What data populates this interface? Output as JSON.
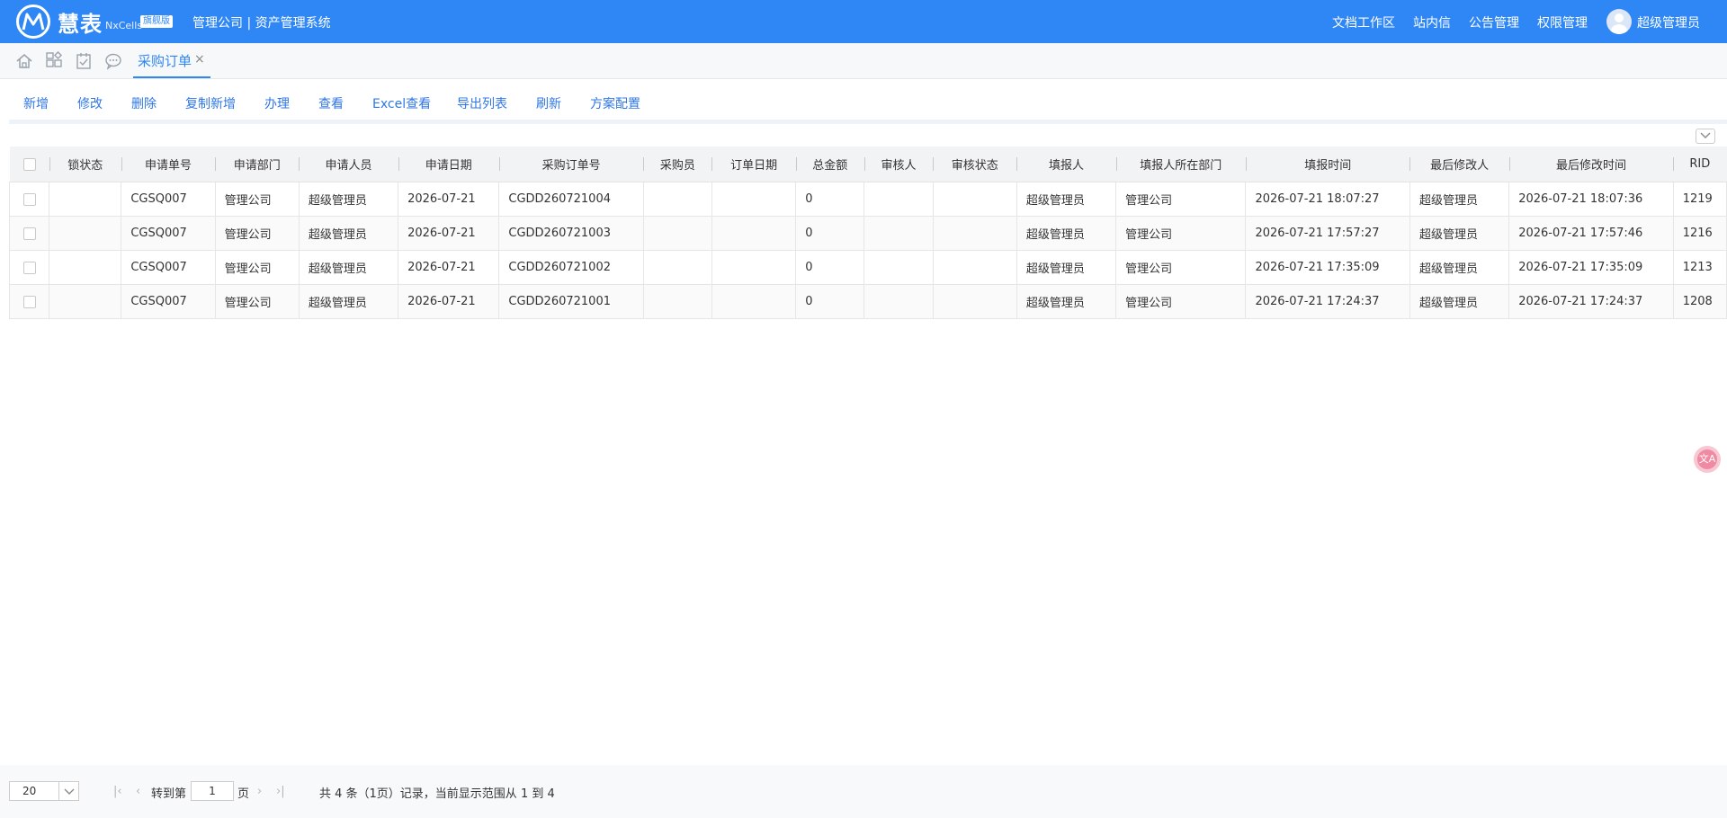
{
  "header": {
    "brand_name": "慧表",
    "brand_en": "NxCells",
    "edition": "旗舰版",
    "system_title": "管理公司 | 资产管理系统",
    "links": [
      "文档工作区",
      "站内信",
      "公告管理",
      "权限管理"
    ],
    "user_name": "超级管理员"
  },
  "tabs": {
    "icons": [
      "home-icon",
      "apps-icon",
      "tasks-icon",
      "message-icon"
    ],
    "active_label": "采购订单",
    "close_glyph": "×"
  },
  "toolbar": {
    "buttons": [
      "新增",
      "修改",
      "删除",
      "复制新增",
      "办理",
      "查看",
      "Excel查看",
      "导出列表",
      "刷新",
      "方案配置"
    ]
  },
  "table": {
    "columns": [
      "锁状态",
      "申请单号",
      "申请部门",
      "申请人员",
      "申请日期",
      "采购订单号",
      "采购员",
      "订单日期",
      "总金额",
      "审核人",
      "审核状态",
      "填报人",
      "填报人所在部门",
      "填报时间",
      "最后修改人",
      "最后修改时间",
      "RID"
    ],
    "rows": [
      [
        "",
        "CGSQ007",
        "管理公司",
        "超级管理员",
        "2026-07-21",
        "CGDD260721004",
        "",
        "",
        "0",
        "",
        "",
        "超级管理员",
        "管理公司",
        "2026-07-21 18:07:27",
        "超级管理员",
        "2026-07-21 18:07:36",
        "1219"
      ],
      [
        "",
        "CGSQ007",
        "管理公司",
        "超级管理员",
        "2026-07-21",
        "CGDD260721003",
        "",
        "",
        "0",
        "",
        "",
        "超级管理员",
        "管理公司",
        "2026-07-21 17:57:27",
        "超级管理员",
        "2026-07-21 17:57:46",
        "1216"
      ],
      [
        "",
        "CGSQ007",
        "管理公司",
        "超级管理员",
        "2026-07-21",
        "CGDD260721002",
        "",
        "",
        "0",
        "",
        "",
        "超级管理员",
        "管理公司",
        "2026-07-21 17:35:09",
        "超级管理员",
        "2026-07-21 17:35:09",
        "1213"
      ],
      [
        "",
        "CGSQ007",
        "管理公司",
        "超级管理员",
        "2026-07-21",
        "CGDD260721001",
        "",
        "",
        "0",
        "",
        "",
        "超级管理员",
        "管理公司",
        "2026-07-21 17:24:37",
        "超级管理员",
        "2026-07-21 17:24:37",
        "1208"
      ]
    ]
  },
  "float_badge": {
    "glyph": "文A"
  },
  "pagination": {
    "page_size": "20",
    "goto_prefix": "转到第",
    "current_page": "1",
    "goto_suffix": "页",
    "summary": "共 4 条（1页）记录，当前显示范围从 1 到 4"
  }
}
